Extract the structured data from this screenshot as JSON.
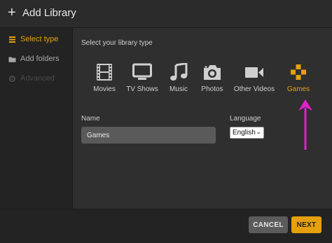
{
  "header": {
    "title": "Add Library"
  },
  "sidebar": {
    "items": [
      {
        "label": "Select type",
        "icon": "list-icon",
        "state": "active"
      },
      {
        "label": "Add folders",
        "icon": "folder-icon",
        "state": "normal"
      },
      {
        "label": "Advanced",
        "icon": "gear-icon",
        "state": "disabled"
      }
    ]
  },
  "main": {
    "prompt": "Select your library type",
    "types": [
      {
        "label": "Movies",
        "icon": "film-icon"
      },
      {
        "label": "TV Shows",
        "icon": "tv-icon"
      },
      {
        "label": "Music",
        "icon": "music-note-icon"
      },
      {
        "label": "Photos",
        "icon": "camera-icon"
      },
      {
        "label": "Other Videos",
        "icon": "video-camera-icon"
      },
      {
        "label": "Games",
        "icon": "gamepad-icon",
        "selected": true
      }
    ],
    "name_label": "Name",
    "name_value": "Games",
    "language_label": "Language",
    "language_value": "English"
  },
  "footer": {
    "cancel_label": "CANCEL",
    "next_label": "NEXT"
  },
  "colors": {
    "accent": "#e5a00d",
    "annotation_arrow": "#e020c8"
  }
}
